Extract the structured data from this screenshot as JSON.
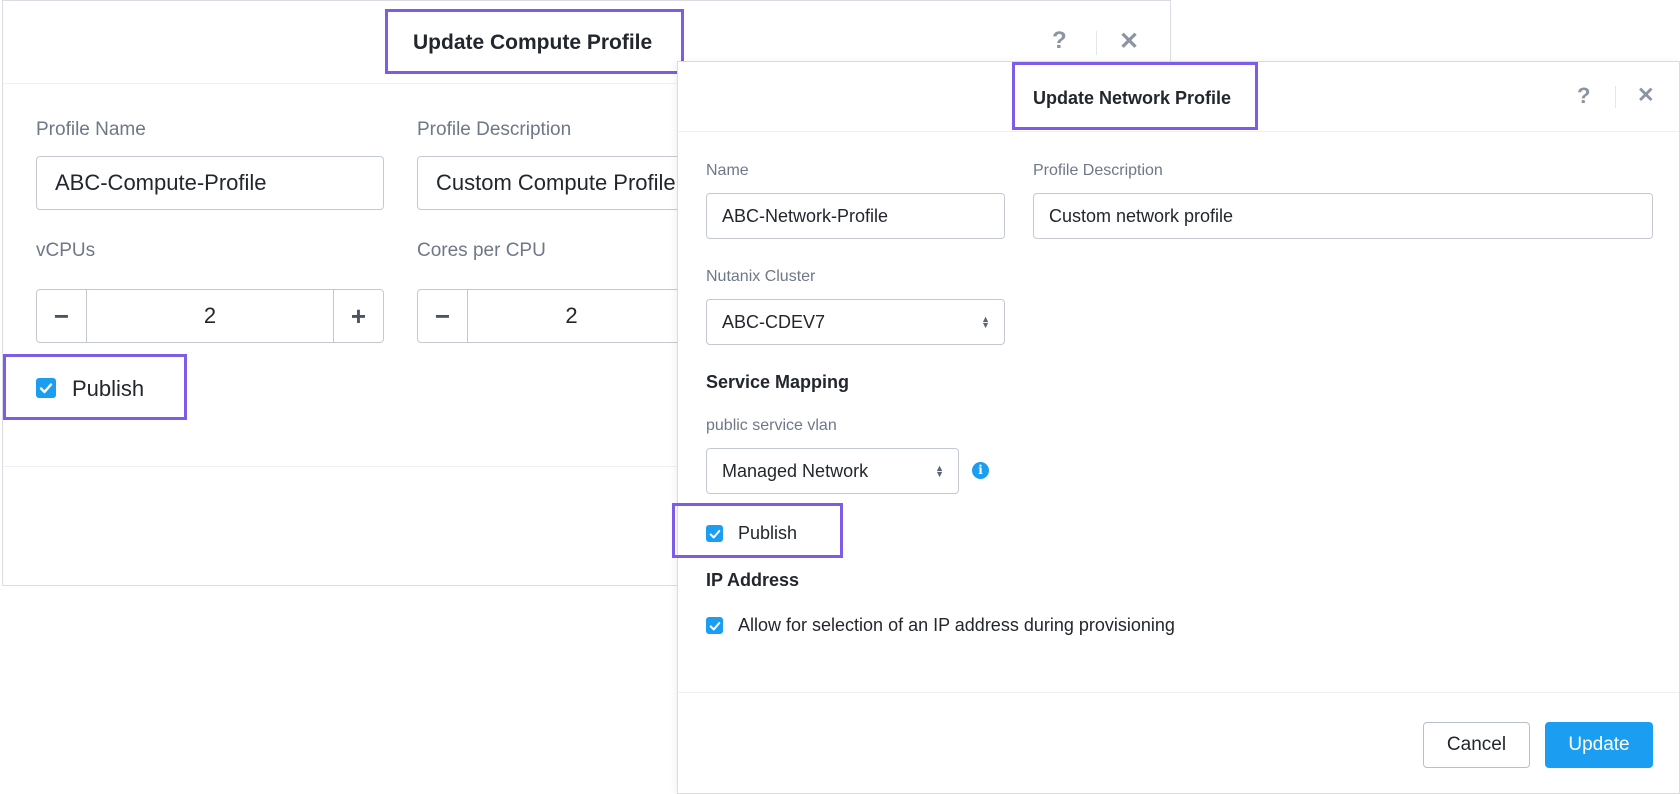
{
  "compute": {
    "title": "Update Compute Profile",
    "help_icon": "?",
    "close_icon": "✕",
    "profile_name_label": "Profile Name",
    "profile_name_value": "ABC-Compute-Profile",
    "profile_desc_label": "Profile Description",
    "profile_desc_value": "Custom Compute Profile",
    "vcpus_label": "vCPUs",
    "vcpus_value": "2",
    "cores_label": "Cores per CPU",
    "cores_value": "2",
    "minus": "−",
    "plus": "+",
    "publish_label": "Publish",
    "publish_checked": true
  },
  "network": {
    "title": "Update Network Profile",
    "help_icon": "?",
    "close_icon": "✕",
    "name_label": "Name",
    "name_value": "ABC-Network-Profile",
    "desc_label": "Profile Description",
    "desc_value": "Custom network profile",
    "cluster_label": "Nutanix Cluster",
    "cluster_value": "ABC-CDEV7",
    "service_mapping_heading": "Service Mapping",
    "vlan_label": "public service vlan",
    "vlan_value": "Managed Network",
    "info_icon": "i",
    "publish_label": "Publish",
    "publish_checked": true,
    "ip_heading": "IP Address",
    "ip_option_label": "Allow for selection of an IP address during provisioning",
    "ip_option_checked": true,
    "cancel_label": "Cancel",
    "update_label": "Update"
  },
  "colors": {
    "accent": "#1b9ef2",
    "highlight": "#7d5ce8"
  }
}
